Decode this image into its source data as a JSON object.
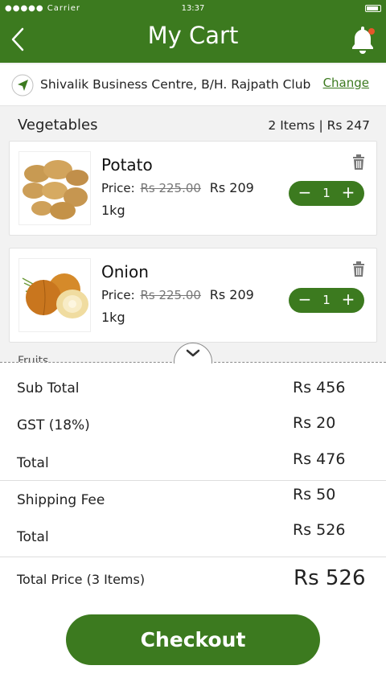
{
  "status_bar": {
    "carrier": "●●●●● Carrier",
    "time": "13:37"
  },
  "header": {
    "title": "My Cart",
    "back_icon": "chevron-left-icon",
    "bell_icon": "bell-icon",
    "badge_color": "#e8562a"
  },
  "address": {
    "text": "Shivalik Business Centre, B/H. Rajpath Club",
    "change_label": "Change",
    "icon": "location-arrow-icon"
  },
  "section": {
    "title": "Vegetables",
    "meta": "2 Items | Rs 247"
  },
  "items": [
    {
      "name": "Potato",
      "price_label": "Price:",
      "old_price": "Rs 225.00",
      "new_price": "Rs 209",
      "quantity": "1kg",
      "count": "1",
      "minus": "−",
      "plus": "+"
    },
    {
      "name": "Onion",
      "price_label": "Price:",
      "old_price": "Rs 225.00",
      "new_price": "Rs 209",
      "quantity": "1kg",
      "count": "1",
      "minus": "−",
      "plus": "+"
    }
  ],
  "next_section_peek": "Fruits",
  "summary": {
    "rows": [
      {
        "label": "Sub Total",
        "value": "Rs 456"
      },
      {
        "label": "GST (18%)",
        "value": "Rs 20"
      },
      {
        "label": "Total",
        "value": "Rs 476"
      },
      {
        "label": "Shipping Fee",
        "value": "Rs 50"
      },
      {
        "label": "Total",
        "value": "Rs 526"
      }
    ],
    "total_price_label": "Total Price (3 Items)",
    "total_price_value": "Rs 526"
  },
  "checkout_label": "Checkout",
  "colors": {
    "brand": "#3c7a1f",
    "background": "#f2f2f2"
  }
}
